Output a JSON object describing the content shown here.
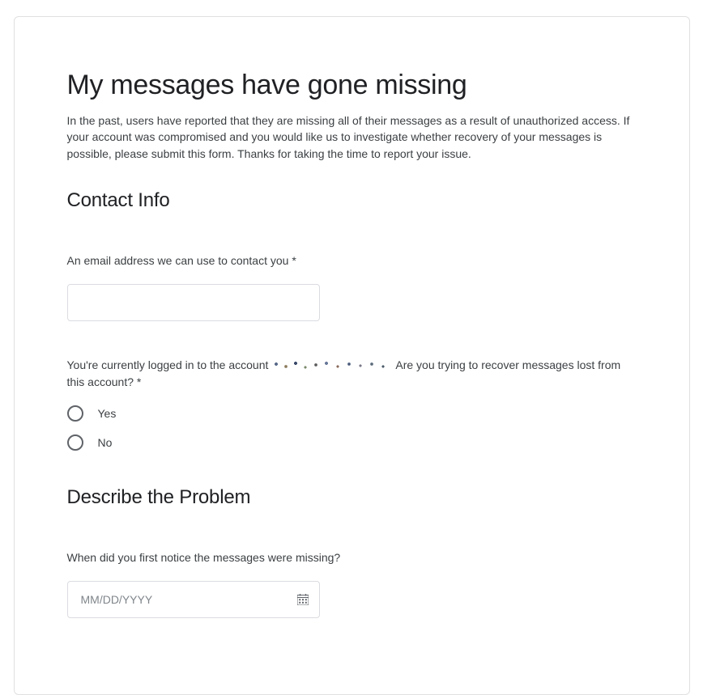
{
  "title": "My messages have gone missing",
  "intro": "In the past, users have reported that they are missing all of their messages as a result of unauthorized access. If your account was compromised and you would like us to investigate whether recovery of your messages is possible, please submit this form. Thanks for taking the time to report your issue.",
  "sections": {
    "contact": {
      "heading": "Contact Info",
      "email_label": "An email address we can use to contact you *",
      "logged_in_prefix": "You're currently logged in to the account ",
      "logged_in_suffix": "  Are you trying to recover messages lost from this account? *",
      "radio": {
        "yes": "Yes",
        "no": "No"
      }
    },
    "describe": {
      "heading": "Describe the Problem",
      "when_label": "When did you first notice the messages were missing?",
      "date_placeholder": "MM/DD/YYYY"
    }
  }
}
